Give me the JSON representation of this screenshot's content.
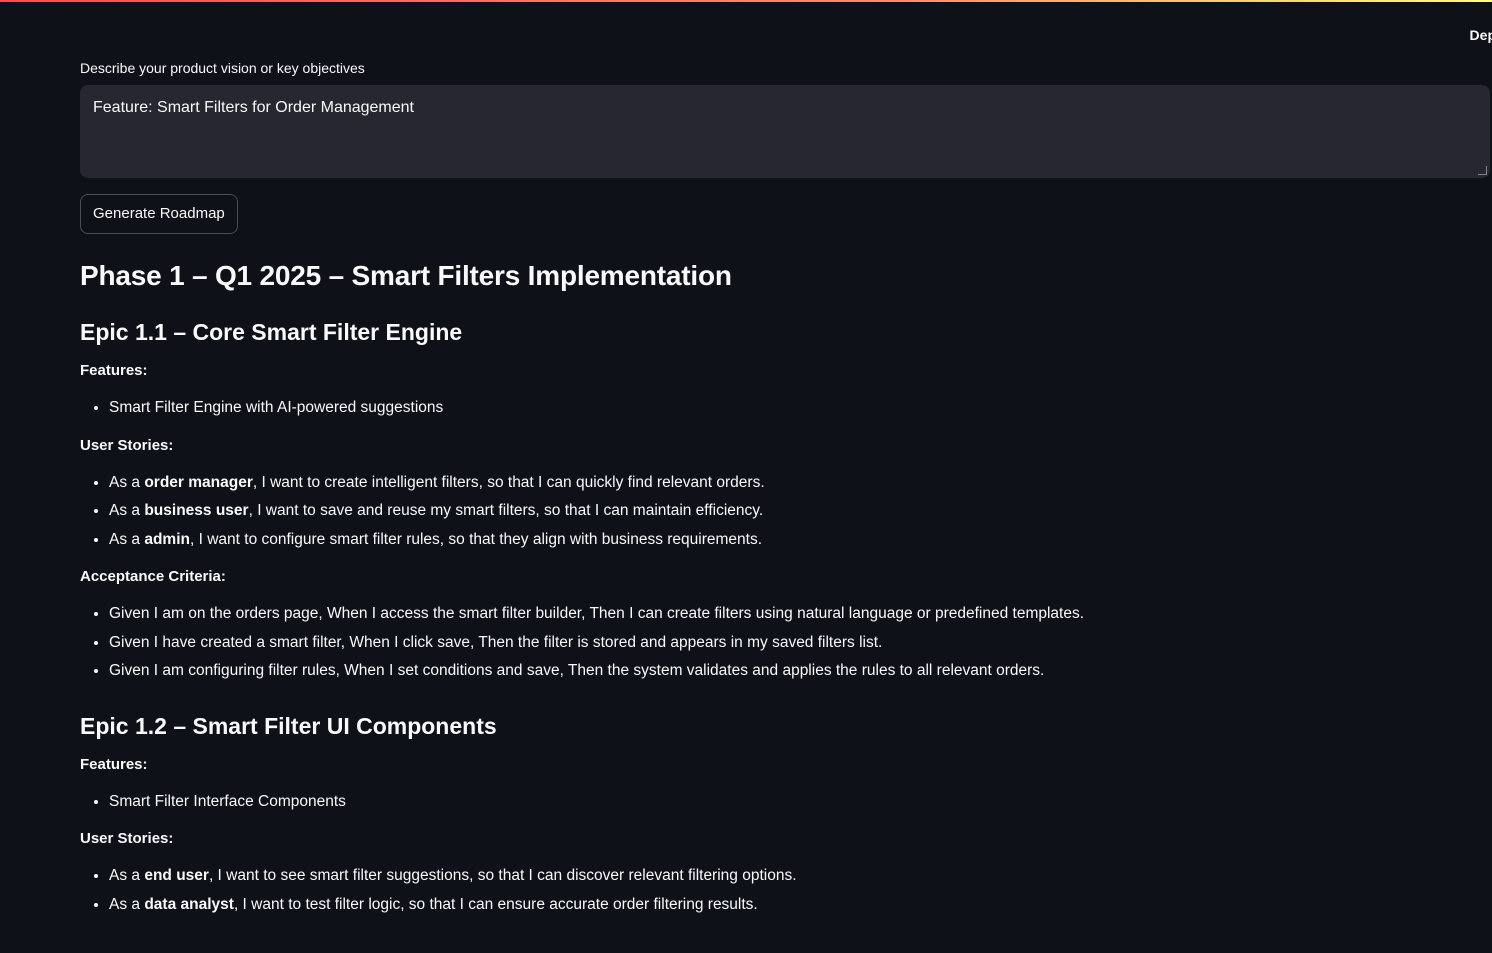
{
  "header": {
    "deploy_label": "Dep"
  },
  "input": {
    "label": "Describe your product vision or key objectives",
    "value": "Feature: Smart Filters for Order Management"
  },
  "generate_button": {
    "label": "Generate Roadmap"
  },
  "roadmap": {
    "phase_title": "Phase 1 – Q1 2025 – Smart Filters Implementation",
    "epics": [
      {
        "title": "Epic 1.1 – Core Smart Filter Engine",
        "features_label": "Features:",
        "features": [
          "Smart Filter Engine with AI-powered suggestions"
        ],
        "stories_label": "User Stories:",
        "stories": [
          {
            "pre": "As a ",
            "role": "order manager",
            "post": ", I want to create intelligent filters, so that I can quickly find relevant orders."
          },
          {
            "pre": "As a ",
            "role": "business user",
            "post": ", I want to save and reuse my smart filters, so that I can maintain efficiency."
          },
          {
            "pre": "As a ",
            "role": "admin",
            "post": ", I want to configure smart filter rules, so that they align with business requirements."
          }
        ],
        "criteria_label": "Acceptance Criteria:",
        "criteria": [
          "Given I am on the orders page, When I access the smart filter builder, Then I can create filters using natural language or predefined templates.",
          "Given I have created a smart filter, When I click save, Then the filter is stored and appears in my saved filters list.",
          "Given I am configuring filter rules, When I set conditions and save, Then the system validates and applies the rules to all relevant orders."
        ]
      },
      {
        "title": "Epic 1.2 – Smart Filter UI Components",
        "features_label": "Features:",
        "features": [
          "Smart Filter Interface Components"
        ],
        "stories_label": "User Stories:",
        "stories": [
          {
            "pre": "As a ",
            "role": "end user",
            "post": ", I want to see smart filter suggestions, so that I can discover relevant filtering options."
          },
          {
            "pre": "As a ",
            "role": "data analyst",
            "post": ", I want to test filter logic, so that I can ensure accurate order filtering results."
          }
        ]
      }
    ]
  }
}
